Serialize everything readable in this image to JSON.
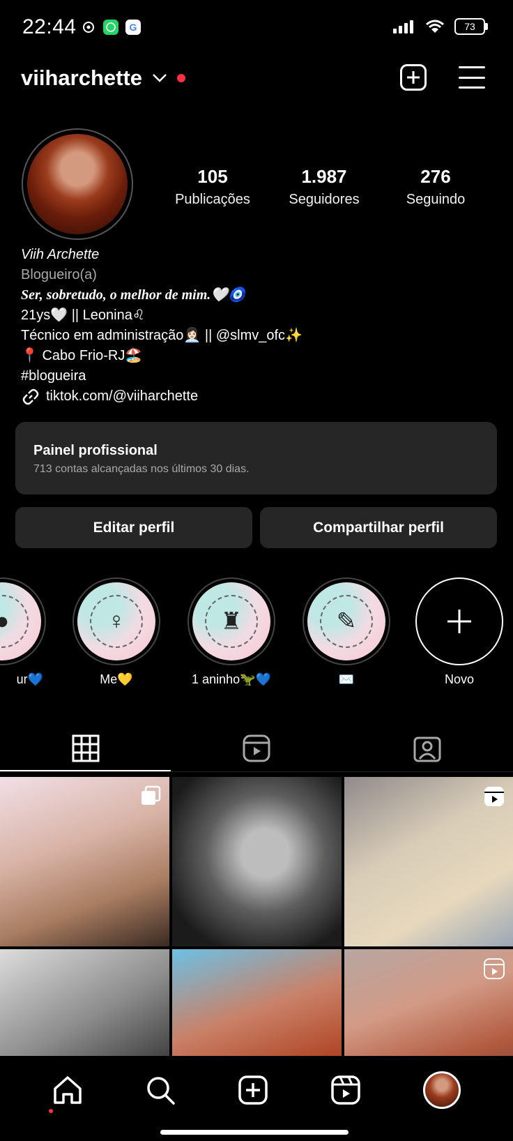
{
  "status_bar": {
    "time": "22:44",
    "battery": "73",
    "icons": [
      "sync-icon",
      "whatsapp-icon",
      "google-icon",
      "signal-icon",
      "wifi-icon",
      "battery-icon"
    ]
  },
  "header": {
    "username": "viiharchette"
  },
  "profile": {
    "stats": [
      {
        "value": "105",
        "label": "Publicações"
      },
      {
        "value": "1.987",
        "label": "Seguidores"
      },
      {
        "value": "276",
        "label": "Seguindo"
      }
    ],
    "bio": {
      "name": "Viih Archette",
      "category": "Blogueiro(a)",
      "line1": "Ser, sobretudo, o melhor de mim.🤍🧿",
      "line2": "21ys🤍 || Leonina♌",
      "line3": "Técnico em administração👩🏻‍💼 || @slmv_ofc✨",
      "line4": "📍 Cabo Frio-RJ🏖️",
      "line5": "#blogueira",
      "link": "tiktok.com/@viiharchette"
    }
  },
  "panel": {
    "title": "Painel profissional",
    "subtitle": "713 contas alcançadas nos últimos 30 dias."
  },
  "buttons": {
    "edit": "Editar perfil",
    "share": "Compartilhar perfil"
  },
  "highlights": [
    {
      "label": "ur💙"
    },
    {
      "label": "Me💛"
    },
    {
      "label": "1 aninho🦖💙"
    },
    {
      "label": "✉️"
    },
    {
      "label": "Novo"
    }
  ],
  "colors": {
    "background": "#000000",
    "surface": "#262626",
    "notification": "#ff3040",
    "secondary_text": "#a8a8a8"
  }
}
